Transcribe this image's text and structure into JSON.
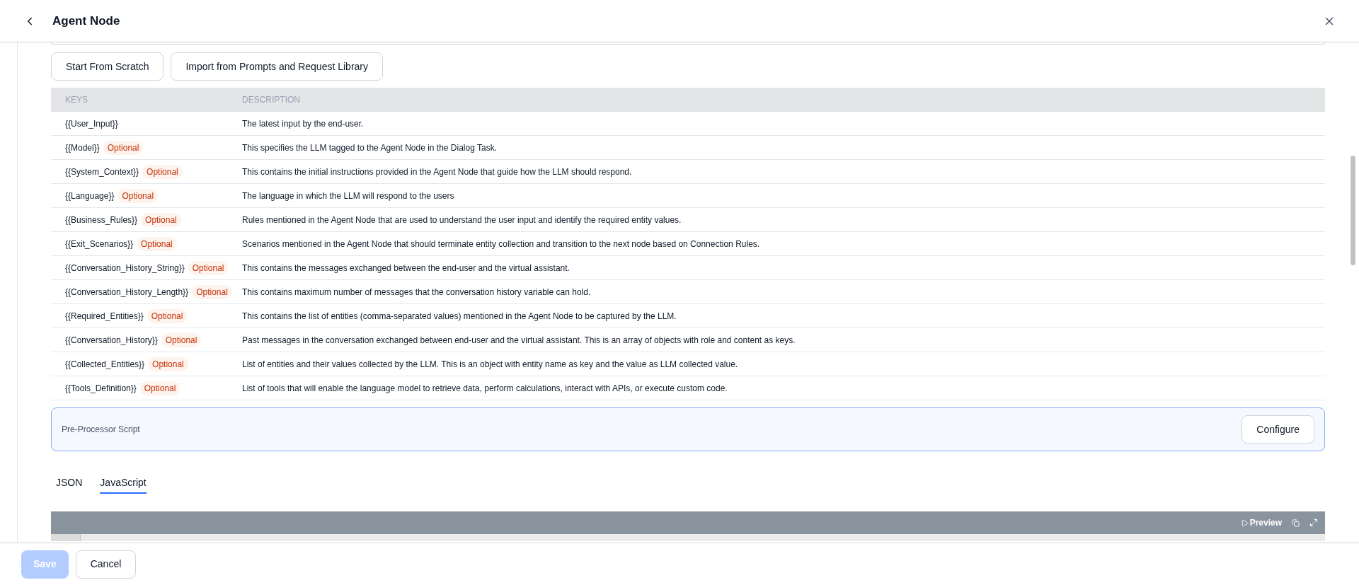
{
  "header": {
    "title": "Agent Node"
  },
  "actions": [
    "Start From Scratch",
    "Import from Prompts and Request Library"
  ],
  "table": {
    "columns": [
      "KEYS",
      "DESCRIPTION"
    ],
    "rows": [
      {
        "key": "{{User_Input}}",
        "description": "The latest input by the end-user."
      },
      {
        "key": "{{Model}}",
        "badge": "Optional",
        "description": "This specifies the LLM tagged to the Agent Node in the Dialog Task."
      },
      {
        "key": "{{System_Context}}",
        "badge": "Optional",
        "description": "This contains the initial instructions provided in the Agent Node that guide how the LLM should respond."
      },
      {
        "key": "{{Language}}",
        "badge": "Optional",
        "description": "The language in which the LLM will respond to the users"
      },
      {
        "key": "{{Business_Rules}}",
        "badge": "Optional",
        "description": "Rules mentioned in the Agent Node that are used to understand the user input and identify the required entity values."
      },
      {
        "key": "{{Exit_Scenarios}}",
        "badge": "Optional",
        "description": "Scenarios mentioned in the Agent Node that should terminate entity collection and transition to the next node based on Connection Rules."
      },
      {
        "key": "{{Conversation_History_String}}",
        "badge": "Optional",
        "description": "This contains the messages exchanged between the end-user and the virtual assistant."
      },
      {
        "key": "{{Conversation_History_Length}}",
        "badge": "Optional",
        "description": "This contains maximum number of messages that the conversation history variable can hold."
      },
      {
        "key": "{{Required_Entities}}",
        "badge": "Optional",
        "description": "This contains the list of entities (comma-separated values) mentioned in the Agent Node to be captured by the LLM."
      },
      {
        "key": "{{Conversation_History}}",
        "badge": "Optional",
        "description": "Past messages in the conversation exchanged between end-user and the virtual assistant. This is an array of objects with role and content as keys."
      },
      {
        "key": "{{Collected_Entities}}",
        "badge": "Optional",
        "description": "List of entities and their values collected by the LLM. This is an object with entity name as key and the value as LLM collected value."
      },
      {
        "key": "{{Tools_Definition}}",
        "badge": "Optional",
        "description": "List of tools that will enable the language model to retrieve data, perform calculations, interact with APIs, or execute custom code."
      }
    ]
  },
  "preprocessor": {
    "label": "Pre-Processor Script",
    "button": "Configure"
  },
  "tabs": [
    {
      "label": "JSON",
      "selected": false
    },
    {
      "label": "JavaScript",
      "selected": true
    }
  ],
  "editor": {
    "preview": "Preview"
  },
  "footer": {
    "save": {
      "label": "Save",
      "disabled": true
    },
    "cancel": "Cancel"
  }
}
